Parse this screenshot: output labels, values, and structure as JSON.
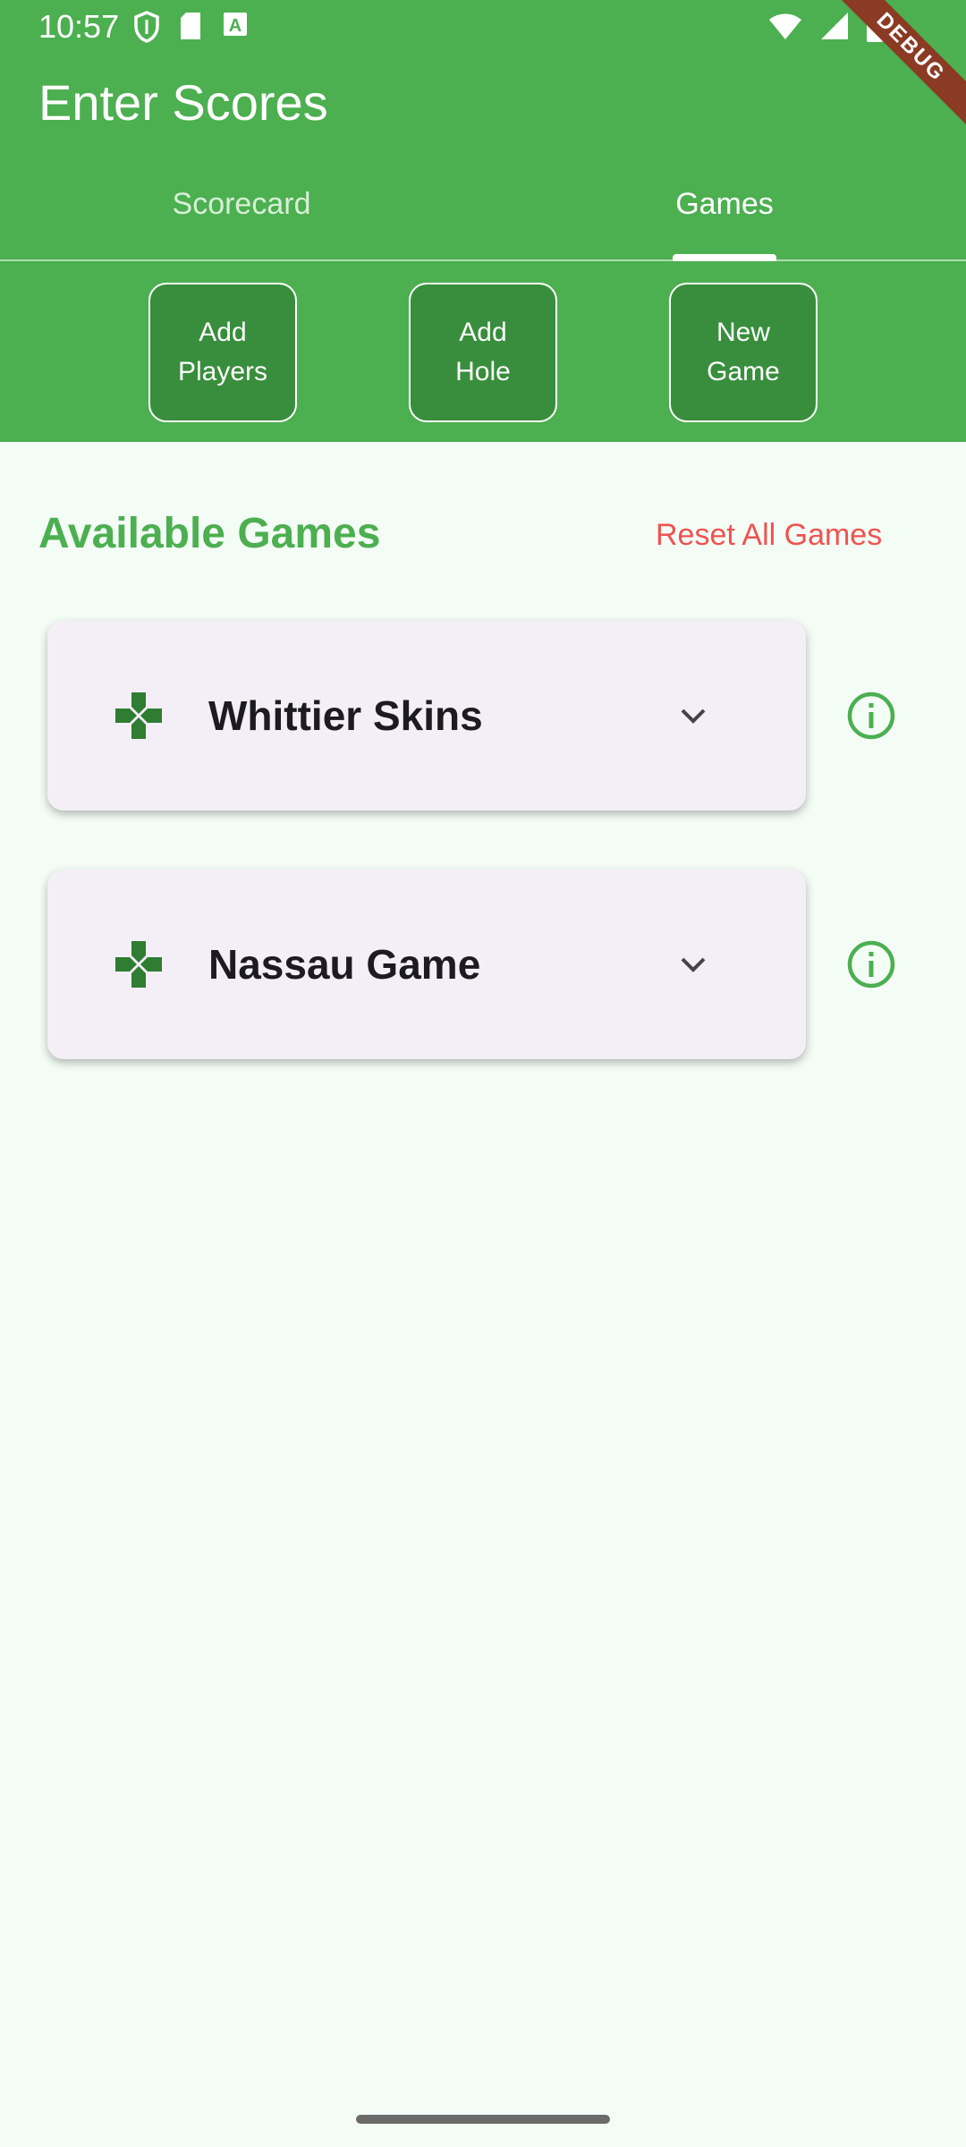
{
  "status_bar": {
    "time": "10:57",
    "left_icons": [
      "shield-icon",
      "sd-card-icon",
      "text-a-icon"
    ],
    "right_icons": [
      "wifi-icon",
      "signal-icon",
      "battery-icon"
    ]
  },
  "debug_banner": "DEBUG",
  "app_bar": {
    "title": "Enter Scores"
  },
  "tabs": [
    {
      "label": "Scorecard",
      "selected": false
    },
    {
      "label": "Games",
      "selected": true
    }
  ],
  "actions": {
    "add_players": [
      "Add",
      "Players"
    ],
    "add_hole": [
      "Add",
      "Hole"
    ],
    "new_game": [
      "New",
      "Game"
    ]
  },
  "content": {
    "section_title": "Available Games",
    "reset_label": "Reset All Games",
    "games": [
      {
        "name": "Whittier Skins",
        "icon": "gamepad-icon",
        "expand_icon": "chevron-down-icon",
        "info_icon": "info-icon"
      },
      {
        "name": "Nassau Game",
        "icon": "gamepad-icon",
        "expand_icon": "chevron-down-icon",
        "info_icon": "info-icon"
      }
    ]
  },
  "colors": {
    "primary": "#4caf50",
    "button_fill": "#388e3c",
    "card_bg": "#f4eff7",
    "page_bg": "#f4fcf6",
    "reset_red": "#ef5350",
    "icon_dark_green": "#2e7d32",
    "debug_ribbon": "#8b3a24"
  }
}
